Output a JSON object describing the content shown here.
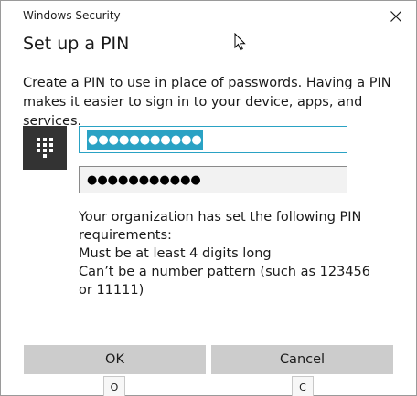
{
  "window": {
    "title": "Windows Security"
  },
  "dialog": {
    "heading": "Set up a PIN",
    "description": "Create a PIN to use in place of passwords. Having a PIN makes it easier to sign in to your device, apps, and services."
  },
  "pin": {
    "new_pin_value": "●●●●●●●●●●●",
    "confirm_pin_value": "●●●●●●●●●●●"
  },
  "requirements": {
    "line1": "Your organization has set the following PIN",
    "line2": "requirements:",
    "line3": "Must be at least 4 digits long",
    "line4": "Can’t be a number pattern (such as 123456",
    "line5": "or 11111)"
  },
  "buttons": {
    "ok_label": "OK",
    "cancel_label": "Cancel",
    "ok_keytip": "O",
    "cancel_keytip": "C"
  },
  "icons": {
    "keypad": "keypad-icon",
    "close": "close-icon",
    "cursor": "mouse-cursor"
  },
  "colors": {
    "accent": "#2aa2c4",
    "button_bg": "#cccccc",
    "tile_bg": "#333333"
  }
}
